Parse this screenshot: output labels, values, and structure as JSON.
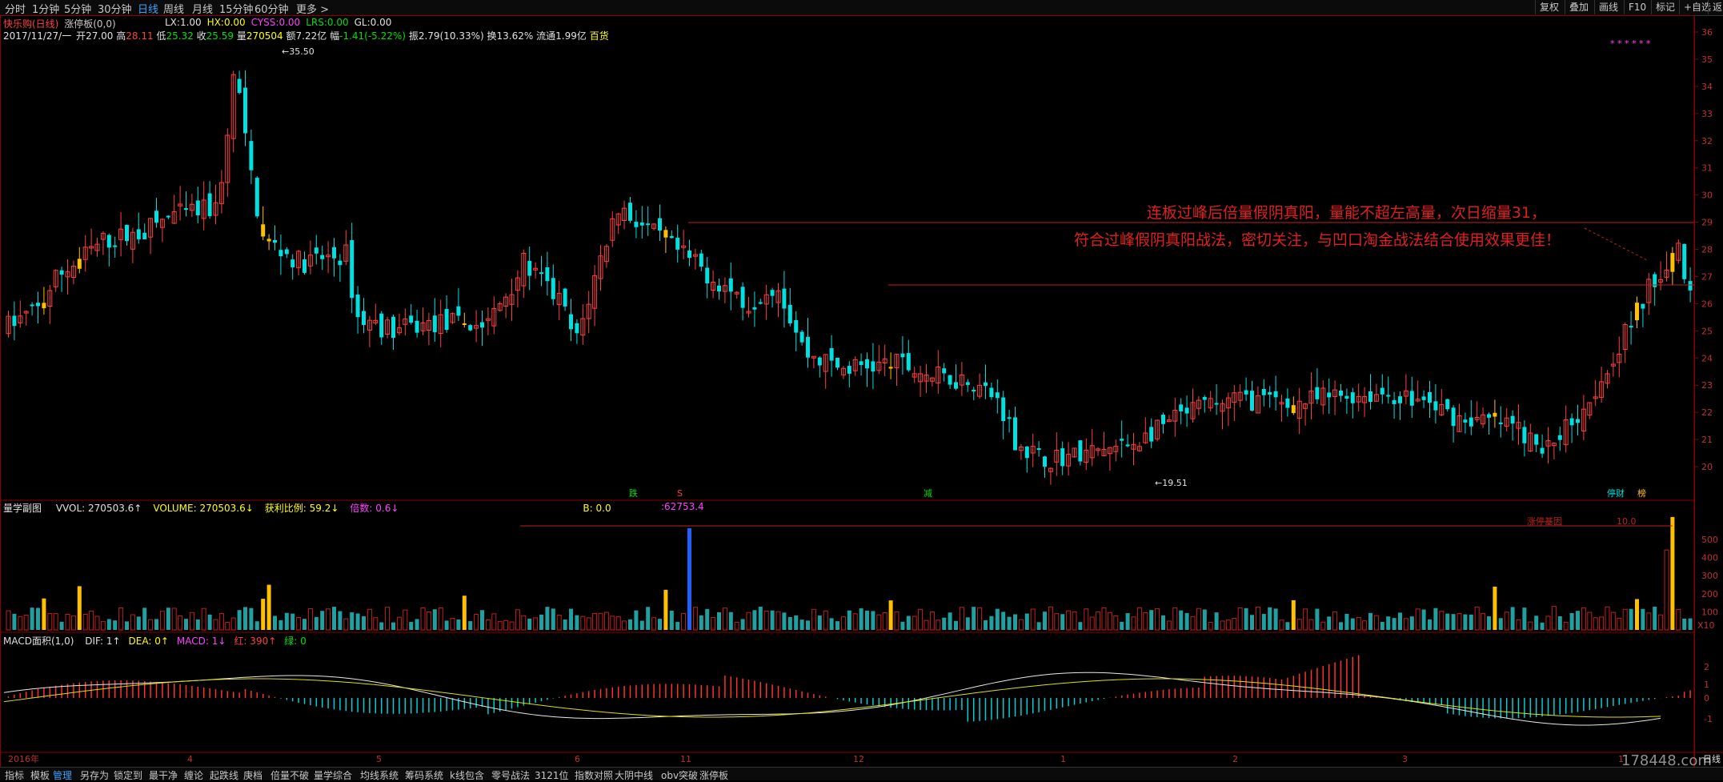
{
  "toolbar": {
    "periods": [
      "分时",
      "1分钟",
      "5分钟",
      "30分钟",
      "日线",
      "周线",
      "月线",
      "15分钟",
      "60分钟",
      "更多 >"
    ],
    "active_period": "日线",
    "right_buttons": [
      "复权",
      "叠加",
      "画线",
      "F10",
      "标记",
      "+自选",
      "返"
    ]
  },
  "main_panel": {
    "stock_name": "快乐购(日线)",
    "indicator_name": "涨停板(0,0)",
    "params": [
      {
        "label": "LX:",
        "value": "1.00",
        "color": "#e0e0e0"
      },
      {
        "label": "HX:",
        "value": "0.00",
        "color": "#ffff00"
      },
      {
        "label": "CYSS:",
        "value": "0.00",
        "color": "#ff40ff"
      },
      {
        "label": "LRS:",
        "value": "0.00",
        "color": "#00e000"
      },
      {
        "label": "GL:",
        "value": "0.00",
        "color": "#e0e0e0"
      }
    ],
    "quote": {
      "date": "2017/11/27/一",
      "open_label": "开",
      "open": "27.00",
      "high_label": "高",
      "high": "28.11",
      "low_label": "低",
      "low": "25.32",
      "close_label": "收",
      "close": "25.59",
      "vol_label": "量",
      "vol": "270504",
      "amount_label": "额",
      "amount": "7.22亿",
      "change_label": "幅",
      "change": "-1.41(-5.22%)",
      "amplitude_label": "振",
      "amplitude": "2.79(10.33%)",
      "turnover_label": "换",
      "turnover": "13.62%",
      "float_label": "流通",
      "float": "1.99亿",
      "sector": "百货"
    },
    "y_axis": [
      "36",
      "35",
      "34",
      "33",
      "32",
      "31",
      "30",
      "29",
      "28",
      "27",
      "26",
      "25",
      "24",
      "23",
      "22",
      "21",
      "20"
    ],
    "high_label": "35.50",
    "low_label": "19.51",
    "annotation_line1": "连板过峰后倍量假阴真阳，量能不超左高量，次日缩量31，",
    "annotation_line2": "符合过峰假阴真阳战法，密切关注，与凹口淘金战法结合使用效果更佳！",
    "marker_fall": "跌",
    "marker_s": "S",
    "marker_reduce": "减",
    "marker_tingcai": "停财",
    "marker_bang": "榜",
    "stars": "* * * * * *"
  },
  "volume_panel": {
    "title": "量学副图",
    "items": [
      {
        "text": "VVOL: 270503.6↑",
        "color": "#e0e0e0"
      },
      {
        "text": "VOLUME: 270503.6↓",
        "color": "#ffff00"
      },
      {
        "text": "获利比例: 59.2↓",
        "color": "#ffff00"
      },
      {
        "text": "倍数: 0.6↓",
        "color": "#ff40ff"
      },
      {
        "text": "B: 0.0",
        "color": "#ffff00"
      }
    ],
    "peak_value": ":62753.4",
    "zhangting_label": "涨停基因",
    "ratio_label": "10.0",
    "y_axis": [
      "500",
      "400",
      "300",
      "200",
      "100"
    ],
    "unit": "X10"
  },
  "macd_panel": {
    "title": "MACD面积(1,0)",
    "items": [
      {
        "text": "DIF: 1↑",
        "color": "#e0e0e0"
      },
      {
        "text": "DEA: 0↑",
        "color": "#ffff00"
      },
      {
        "text": "MACD: 1↓",
        "color": "#ff40ff"
      },
      {
        "text": "红: 390↑",
        "color": "#ff4040"
      },
      {
        "text": "绿: 0",
        "color": "#00e000"
      }
    ],
    "y_axis": [
      "2",
      "1",
      "0",
      "-1"
    ]
  },
  "x_axis": [
    "2016年",
    "4",
    "5",
    "6",
    "11",
    "12",
    "1",
    "2",
    "3",
    "1"
  ],
  "watermark": "178448.com",
  "right_corner_label": "日线",
  "bottom_tabs": [
    "指标",
    "模板",
    "管理",
    "另存为",
    "锁定到",
    "最干净",
    "缠论",
    "起跌线",
    "庚档",
    "倍量不破",
    "量学综合",
    "均线系统",
    "筹码系统",
    "k线包含",
    "零号战法",
    "3121位",
    "指数对照",
    "大阴中线",
    "obv突破",
    "涨停板"
  ],
  "active_bottom_tab": "管理"
}
